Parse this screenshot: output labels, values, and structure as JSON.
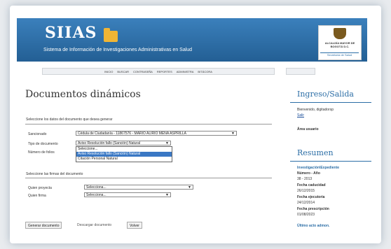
{
  "header": {
    "logo": "SIIAS",
    "subtitle": "Sistema de Información de Investigaciones Administrativas en Salud",
    "crest_text": "ALCALDÍA MAYOR DE BOGOTÁ D.C.",
    "crest_sub": "Secretaría de Salud"
  },
  "nav": [
    "INICIO",
    "BUSCAR",
    "CONTRASEÑA",
    "REPORTES",
    "ADMINISTRA",
    "BITÁCORA"
  ],
  "main": {
    "title": "Documentos dinámicos",
    "section1": "Seleccione los datos del documento que desea generar",
    "sancionado_label": "Sancionado",
    "sancionado_value": "Cédula de Ciudadanía - 11867576 - MARIO ALIRIO MENA ASPRILLA",
    "tipo_label": "Tipo de documento",
    "tipo_value": "Aviso Resolución fallo (Sanción) Natural",
    "folios_label": "Número de folios",
    "dropdown_options": [
      "Seleccione...",
      "Aviso Resolución fallo (Sanción) Natural",
      "Citación Personal Natural"
    ],
    "dropdown_active_index": 1,
    "section2": "Seleccione las firmas del documento",
    "proyecta_label": "Quien proyecta",
    "proyecta_value": "Selecciona...",
    "firma_label": "Quien firma",
    "firma_value": "Selecciona...",
    "btn_generar": "Generar documento",
    "btn_descargar": "Descargar documento",
    "btn_volver": "Volver"
  },
  "side": {
    "ingreso_title": "Ingreso/Salida",
    "welcome": "Bienvenido, digitadorsp",
    "salir": "Salir",
    "area": "Área usuario",
    "resumen_title": "Resumen",
    "inv_label": "Investigación\\Expediente",
    "num_label": "Número - Año",
    "num_value": "38 - 2013",
    "cad_label": "Fecha caducidad",
    "cad_value": "26/12/2015",
    "eje_label": "Fecha ejecutoria",
    "eje_value": "24/12/2014",
    "pres_label": "Fecha prescripción",
    "pres_value": "01/08/2023",
    "ultimo": "Último acto admon."
  }
}
